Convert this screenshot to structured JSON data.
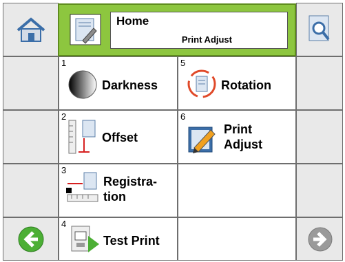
{
  "header": {
    "title": "Home",
    "subtitle": "Print Adjust"
  },
  "menu": {
    "darkness": {
      "number": "1",
      "label": "Darkness"
    },
    "offset": {
      "number": "2",
      "label": "Offset"
    },
    "registration": {
      "number": "3",
      "label_line1": "Registra-",
      "label_line2": "tion"
    },
    "test_print": {
      "number": "4",
      "label": "Test Print"
    },
    "rotation": {
      "number": "5",
      "label": "Rotation"
    },
    "print_adjust": {
      "number": "6",
      "label_line1": "Print",
      "label_line2": "Adjust"
    }
  },
  "icons": {
    "home": "home-icon",
    "settings_doc": "settings-document-icon",
    "search_doc": "search-document-icon",
    "back": "back-arrow-icon",
    "forward": "forward-arrow-icon"
  },
  "colors": {
    "header_green": "#8dc63f",
    "back_arrow_green": "#4caf35",
    "disabled_gray": "#9a9a9a"
  }
}
